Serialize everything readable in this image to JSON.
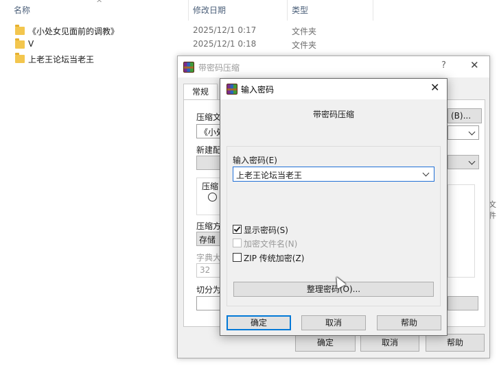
{
  "explorer": {
    "columns": {
      "name": "名称",
      "date": "修改日期",
      "type": "类型"
    },
    "files": [
      {
        "name": "《小处女见面前的调教》",
        "date": "2025/12/1 0:17",
        "type": "文件夹"
      },
      {
        "name": "V",
        "date": "2025/12/1 0:18",
        "type": "文件夹"
      },
      {
        "name": "上老王论坛当老王",
        "date": "",
        "type": ""
      }
    ],
    "right_edge_text": "文件"
  },
  "back_dialog": {
    "title": "带密码压缩",
    "help_glyph": "?",
    "close_glyph": "✕",
    "tab_general": "常规",
    "archive_name_label": "压缩文",
    "archive_name_value": "《小处",
    "new_profile_label": "新建配",
    "format_label": "压缩",
    "method_label": "压缩方",
    "method_value": "存储",
    "dict_label": "字典大",
    "dict_value": "32",
    "split_label": "切分为",
    "browse_button": "(B)...",
    "ok_button": "确定",
    "cancel_button": "取消",
    "help_button": "帮助"
  },
  "front_dialog": {
    "title": "输入密码",
    "close_glyph": "✕",
    "heading": "带密码压缩",
    "password_label": "输入密码(E)",
    "password_value": "上老王论坛当老王",
    "show_password": {
      "label": "显示密码(S)",
      "checked": true
    },
    "encrypt_names": {
      "label": "加密文件名(N)",
      "checked": false,
      "disabled": true
    },
    "zip_legacy": {
      "label": "ZIP 传统加密(Z)",
      "checked": false
    },
    "organize_button": "整理密码(O)...",
    "ok_button": "确定",
    "cancel_button": "取消",
    "help_button": "帮助"
  }
}
